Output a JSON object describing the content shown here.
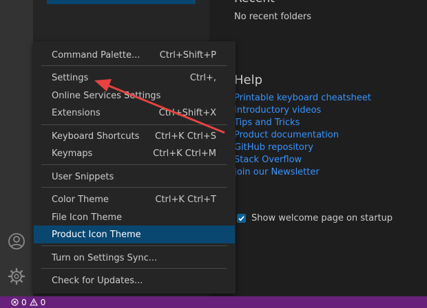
{
  "welcome": {
    "recent_title": "Recent",
    "recent_empty": "No recent folders",
    "help_title": "Help",
    "help_links": [
      "Printable keyboard cheatsheet",
      "Introductory videos",
      "Tips and Tricks",
      "Product documentation",
      "GitHub repository",
      "Stack Overflow",
      "Join our Newsletter"
    ],
    "show_on_startup_label": "Show welcome page on startup",
    "show_on_startup_checked": true
  },
  "menu": {
    "items": [
      {
        "label": "Command Palette...",
        "shortcut": "Ctrl+Shift+P"
      },
      {
        "label": "Settings",
        "shortcut": "Ctrl+,"
      },
      {
        "label": "Online Services Settings",
        "shortcut": ""
      },
      {
        "label": "Extensions",
        "shortcut": "Ctrl+Shift+X"
      },
      {
        "label": "Keyboard Shortcuts",
        "shortcut": "Ctrl+K Ctrl+S"
      },
      {
        "label": "Keymaps",
        "shortcut": "Ctrl+K Ctrl+M"
      },
      {
        "label": "User Snippets",
        "shortcut": ""
      },
      {
        "label": "Color Theme",
        "shortcut": "Ctrl+K Ctrl+T"
      },
      {
        "label": "File Icon Theme",
        "shortcut": ""
      },
      {
        "label": "Product Icon Theme",
        "shortcut": ""
      },
      {
        "label": "Turn on Settings Sync...",
        "shortcut": ""
      },
      {
        "label": "Check for Updates...",
        "shortcut": ""
      }
    ],
    "active_item": "Product Icon Theme"
  },
  "status_bar": {
    "errors": "0",
    "warnings": "0"
  },
  "activity_bar": {
    "icons": [
      "account-icon",
      "manage-gear-icon"
    ]
  },
  "colors": {
    "status_bar": "#68217a",
    "link": "#3794ff",
    "menu_active": "#094771",
    "annotation_arrow": "#e8433f"
  }
}
